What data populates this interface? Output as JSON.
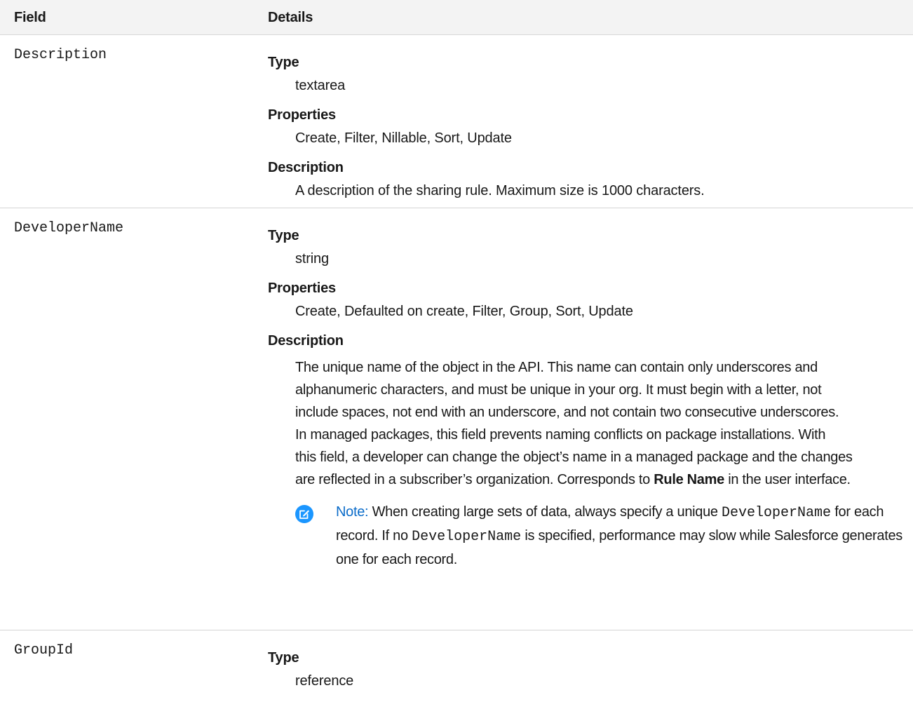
{
  "table": {
    "headers": {
      "field": "Field",
      "details": "Details"
    },
    "rows": [
      {
        "field_name": "Description",
        "type_label": "Type",
        "type_value": "textarea",
        "properties_label": "Properties",
        "properties_value": "Create, Filter, Nillable, Sort, Update",
        "description_label": "Description",
        "description_value": "A description of the sharing rule. Maximum size is 1000 characters."
      },
      {
        "field_name": "DeveloperName",
        "type_label": "Type",
        "type_value": "string",
        "properties_label": "Properties",
        "properties_value": "Create, Defaulted on create, Filter, Group, Sort, Update",
        "description_label": "Description",
        "description_lines": [
          "The unique name of the object in the API. This name can contain only underscores and",
          "alphanumeric characters, and must be unique in your org. It must begin with a letter, not",
          "include spaces, not end with an underscore, and not contain two consecutive underscores.",
          "In managed packages, this field prevents naming conflicts on package installations. With",
          "this field, a developer can change the object’s name in a managed package and the changes",
          "are reflected in a subscriber’s organization. Corresponds to"
        ],
        "description_emphasis": "Rule Name",
        "description_tail": " in the user interface.",
        "note": {
          "icon": "edit-note-icon",
          "label": "Note:",
          "text_1": " When creating large sets of data, always specify a unique ",
          "code_1": "DeveloperName",
          "text_2": " for each record. If no ",
          "code_2": "DeveloperName",
          "text_3": " is specified, performance may slow while Salesforce generates one for each record."
        }
      },
      {
        "field_name": "GroupId",
        "type_label": "Type",
        "type_value": "reference"
      }
    ]
  },
  "colors": {
    "header_bg": "#f3f3f3",
    "divider": "#d4d4d4",
    "note_icon": "#1b96ff",
    "note_label": "#0b6cc9"
  }
}
